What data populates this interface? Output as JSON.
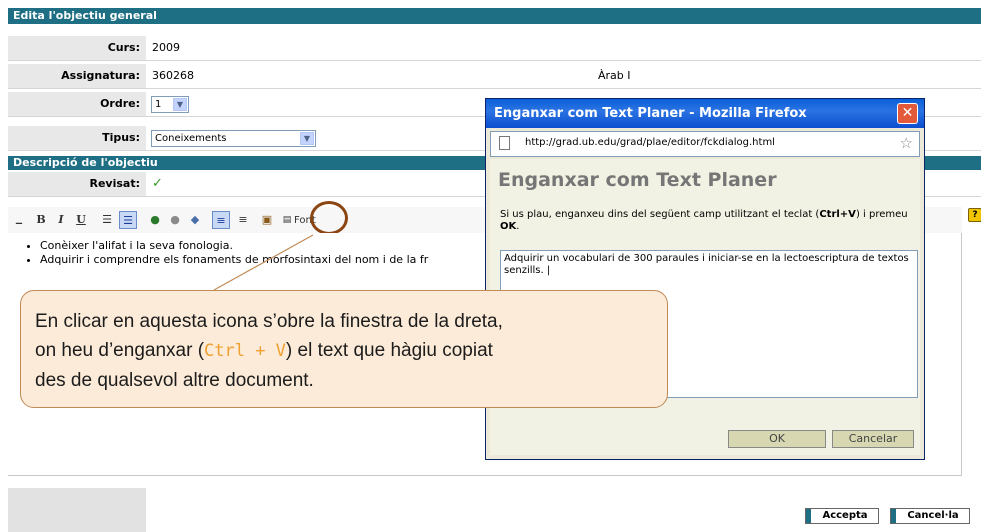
{
  "header": {
    "title": "Edita l'objectiu general"
  },
  "fields": {
    "curs": {
      "label": "Curs:",
      "value": "2009"
    },
    "assignatura": {
      "label": "Assignatura:",
      "value": "360268",
      "name": "Àrab I"
    },
    "ordre": {
      "label": "Ordre:",
      "value": "1"
    },
    "tipus": {
      "label": "Tipus:",
      "value": "Coneixements"
    }
  },
  "section": {
    "title": "Descripció de l'objectiu"
  },
  "revisat": {
    "label": "Revisat:",
    "mark": "✓"
  },
  "toolbar": {
    "bold": "B",
    "italic": "I",
    "underline": "U",
    "font_label": "Font",
    "help": "?"
  },
  "editor": {
    "items": [
      "Conèixer l'alifat i la seva fonologia.",
      "Adquirir i comprendre els fonaments de morfosintaxi del nom i de la fr"
    ]
  },
  "popup": {
    "window_title": "Enganxar com Text Planer - Mozilla Firefox",
    "close": "✕",
    "url": "http://grad.ub.edu/grad/plae/editor/fckdialog.html",
    "heading": "Enganxar com Text Planer",
    "instruction_pre": "Si us plau, enganxeu dins del següent camp utilitzant el teclat (",
    "instruction_key": "Ctrl+V",
    "instruction_mid": ") i premeu ",
    "instruction_ok": "OK",
    "instruction_end": ".",
    "textarea": "Adquirir un vocabulari de 300 paraules i iniciar-se en la lectoescriptura de textos senzills. |",
    "ok_label": "OK",
    "cancel_label": "Cancelar"
  },
  "callout": {
    "line1": "En clicar en aquesta icona s’obre la finestra de la dreta,",
    "line2_pre": "on heu d’enganxar (",
    "line2_key": "Ctrl + V",
    "line2_post": ") el text que hàgiu copiat",
    "line3": "des de qualsevol altre document."
  },
  "actions": {
    "accept": "Accepta",
    "cancel": "Cancel·la"
  },
  "colors": {
    "header": "#1e6f84",
    "callout_bg": "#fcebd9",
    "highlight_ring": "#8b4513"
  }
}
